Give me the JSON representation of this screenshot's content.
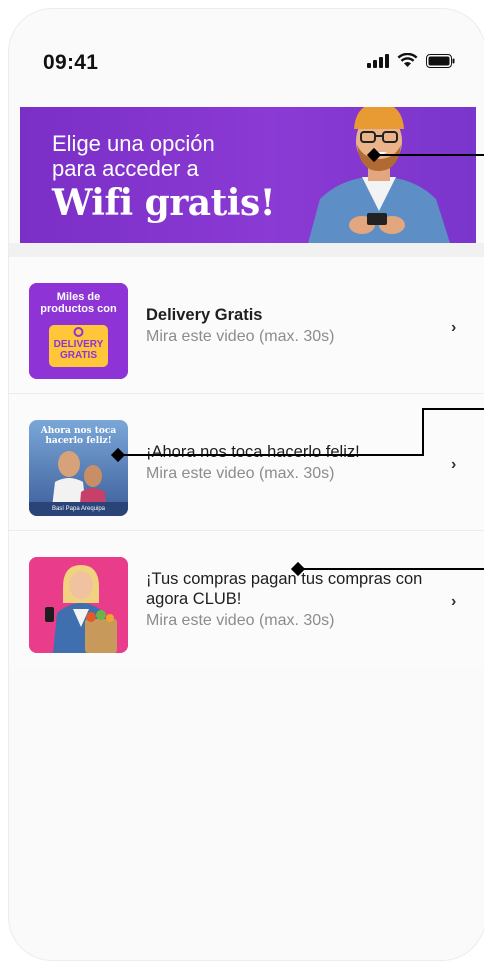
{
  "status_bar": {
    "time": "09:41",
    "icons": [
      "cellular-signal-icon",
      "wifi-icon",
      "battery-icon"
    ]
  },
  "banner": {
    "line1": "Elige una opción",
    "line2": "para acceder a",
    "line3": "Wifi gratis!",
    "background_color": "#7d33c9"
  },
  "list": {
    "items": [
      {
        "title": "Delivery Gratis",
        "subtitle": "Mira este video (max. 30s)",
        "thumb": {
          "line1": "Miles de",
          "line2": "productos con",
          "badge_line1": "DELIVERY",
          "badge_line2": "GRATIS",
          "background_color": "#8e34d6",
          "badge_color": "#ffc63a"
        }
      },
      {
        "title": "¡Ahora nos toca hacerlo feliz!",
        "subtitle": "Mira este video (max. 30s)",
        "thumb": {
          "line1": "Ahora nos toca",
          "line2": "hacerlo feliz!",
          "footer": "Basí Papa Arequipa"
        }
      },
      {
        "title": "¡Tus compras pagan tus compras con agora CLUB!",
        "subtitle": "Mira este video (max. 30s)",
        "thumb": {
          "background_color": "#e93d8c"
        }
      }
    ],
    "chevron": "›"
  }
}
